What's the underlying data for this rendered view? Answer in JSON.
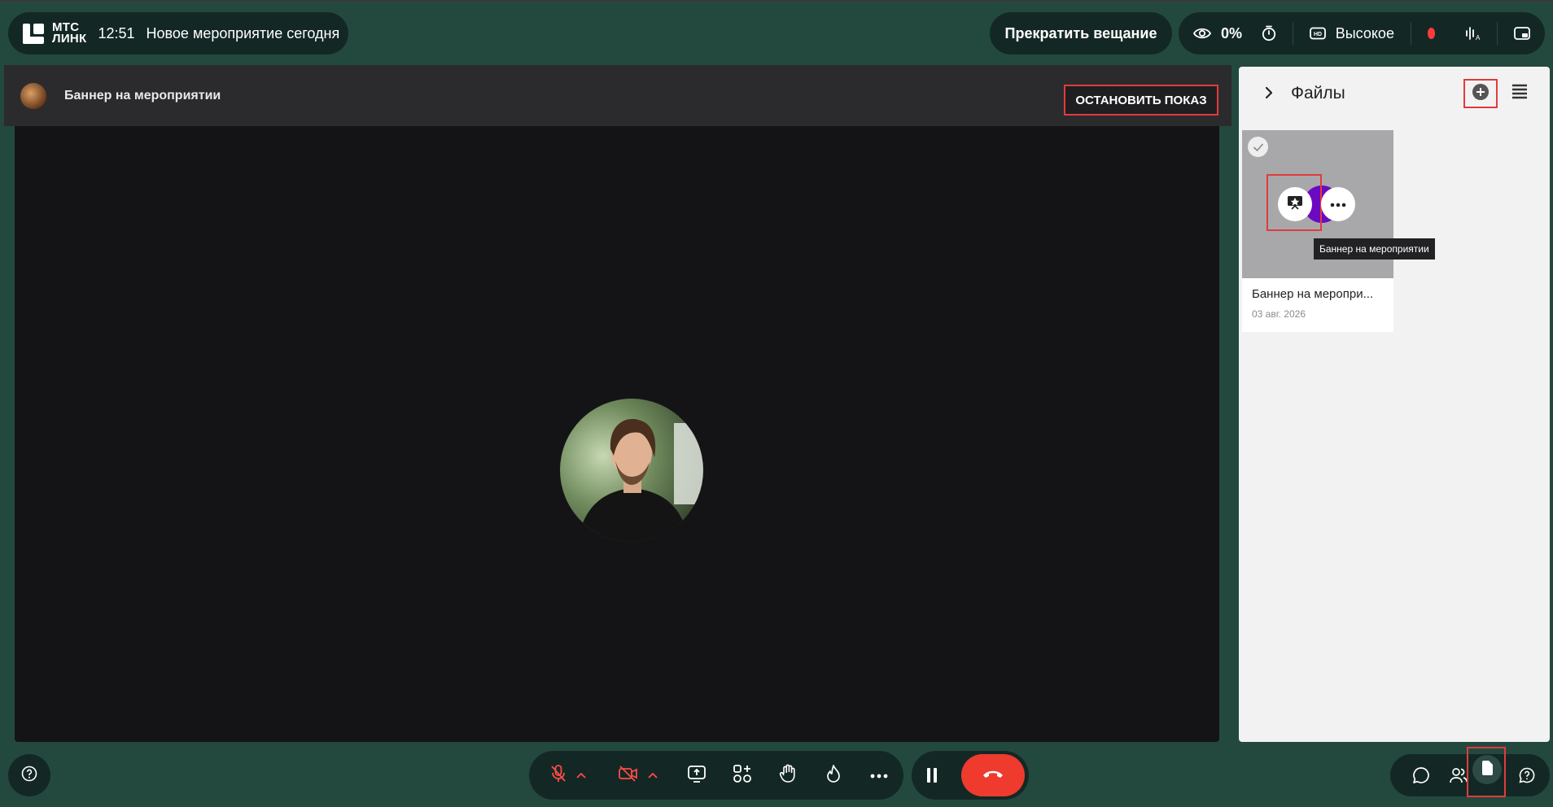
{
  "header": {
    "logo_line1": "МТС",
    "logo_line2": "ЛИНК",
    "time": "12:51",
    "event_title": "Новое мероприятие сегодня",
    "stop_broadcast_label": "Прекратить вещание",
    "viewers_percent": "0%",
    "quality_label": "Высокое"
  },
  "stage": {
    "banner_title": "Баннер на мероприятии",
    "stop_show_label": "ОСТАНОВИТЬ ПОКАЗ"
  },
  "files_panel": {
    "title": "Файлы",
    "files": [
      {
        "name": "Баннер на меропри...",
        "date": "03 авг. 2026",
        "tooltip": "Баннер на мероприятии"
      }
    ]
  },
  "colors": {
    "background": "#23493f",
    "pill": "#132824",
    "stage": "#141417",
    "highlight": "#e13b3b",
    "hangup": "#ef3a2e",
    "record": "#ff3b3b",
    "thumbnail_accent": "#6c0ac2"
  },
  "icons": [
    "eye-icon",
    "timer-icon",
    "hd-icon",
    "record-dot-icon",
    "sound-icon",
    "picture-in-picture-icon",
    "chevron-right-icon",
    "add-file-icon",
    "list-view-icon",
    "check-icon",
    "present-icon",
    "more-icon",
    "mic-off-icon",
    "camera-off-icon",
    "share-screen-icon",
    "add-app-icon",
    "raise-hand-icon",
    "reaction-icon",
    "more-options-icon",
    "pause-icon",
    "hangup-icon",
    "chat-icon",
    "participants-icon",
    "files-icon",
    "help-icon"
  ]
}
